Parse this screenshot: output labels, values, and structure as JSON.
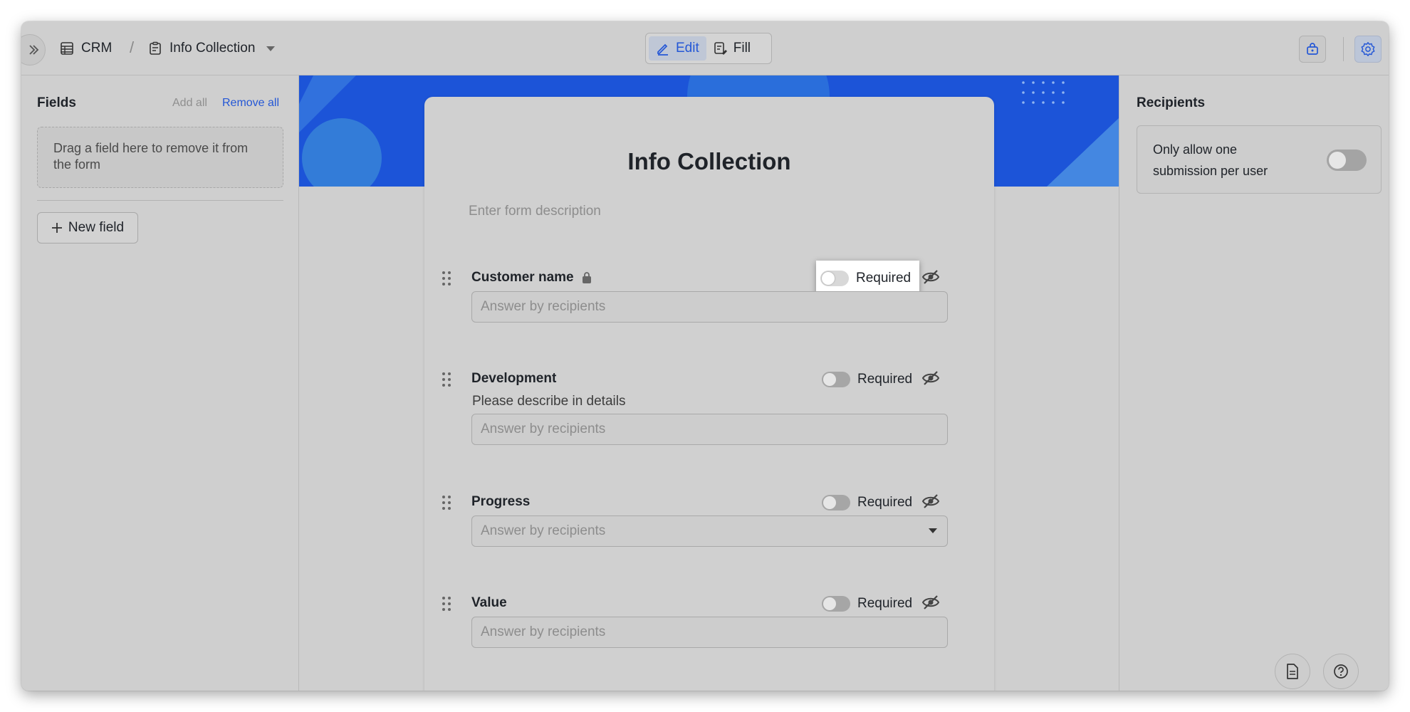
{
  "header": {
    "breadcrumb_root": "CRM",
    "breadcrumb_separator": "/",
    "breadcrumb_current": "Info Collection",
    "modes": {
      "edit": "Edit",
      "fill": "Fill"
    }
  },
  "left_panel": {
    "title": "Fields",
    "add_all": "Add all",
    "remove_all": "Remove all",
    "dropzone_text": "Drag a field here to remove it from the form",
    "new_field": "New field"
  },
  "form": {
    "title": "Info Collection",
    "description_placeholder": "Enter form description",
    "required_label": "Required",
    "fields": [
      {
        "label": "Customer name",
        "locked": true,
        "subtext": "",
        "placeholder": "Answer by recipients",
        "type": "text"
      },
      {
        "label": "Development",
        "locked": false,
        "subtext": "Please describe in details",
        "placeholder": "Answer by recipients",
        "type": "text"
      },
      {
        "label": "Progress",
        "locked": false,
        "subtext": "",
        "placeholder": "Answer by recipients",
        "type": "select"
      },
      {
        "label": "Value",
        "locked": false,
        "subtext": "",
        "placeholder": "Answer by recipients",
        "type": "text"
      }
    ]
  },
  "right_panel": {
    "title": "Recipients",
    "one_submission_label": "Only allow one submission per user"
  },
  "colors": {
    "accent": "#2457d6",
    "banner": "#1c54d8"
  }
}
